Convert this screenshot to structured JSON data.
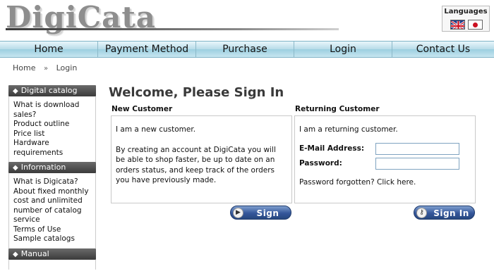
{
  "header": {
    "logo_text": "DigiCata",
    "languages_label": "Languages",
    "flags": [
      "uk-flag-icon",
      "japan-flag-icon"
    ]
  },
  "nav": {
    "items": [
      {
        "label": "Home"
      },
      {
        "label": "Payment Method"
      },
      {
        "label": "Purchase"
      },
      {
        "label": "Login"
      },
      {
        "label": "Contact Us"
      }
    ]
  },
  "breadcrumb": {
    "home": "Home",
    "separator": "»",
    "current": "Login"
  },
  "sidebar": {
    "sections": [
      {
        "title": "Digital catalog",
        "items": [
          "What is download sales?",
          "Product outline",
          "Price list",
          "Hardware requirements"
        ]
      },
      {
        "title": "Information",
        "items": [
          "What is Digicata?",
          "About fixed monthly cost and unlimited number of catalog service",
          "Terms of Use",
          "Sample catalogs"
        ]
      },
      {
        "title": "Manual",
        "items": []
      }
    ]
  },
  "main": {
    "title": "Welcome, Please Sign In",
    "new_customer": {
      "heading": "New Customer",
      "intro": "I am a new customer.",
      "description": "By creating an account at DigiCata you will be able to shop faster, be up to date on an orders status, and keep track of the orders you have previously made.",
      "button_label": "Sign Up"
    },
    "returning_customer": {
      "heading": "Returning Customer",
      "intro": "I am a returning customer.",
      "email_label": "E-Mail Address:",
      "email_value": "",
      "password_label": "Password:",
      "password_value": "",
      "forgot_text": "Password forgotten? Click here.",
      "button_label": "Sign In"
    }
  },
  "colors": {
    "nav_gradient_top": "#e9f6fb",
    "nav_gradient_bottom": "#9ccfe0",
    "sidebar_header": "#4a4a4a",
    "button_blue": "#34569a",
    "title_gray": "#3a3a3a"
  }
}
